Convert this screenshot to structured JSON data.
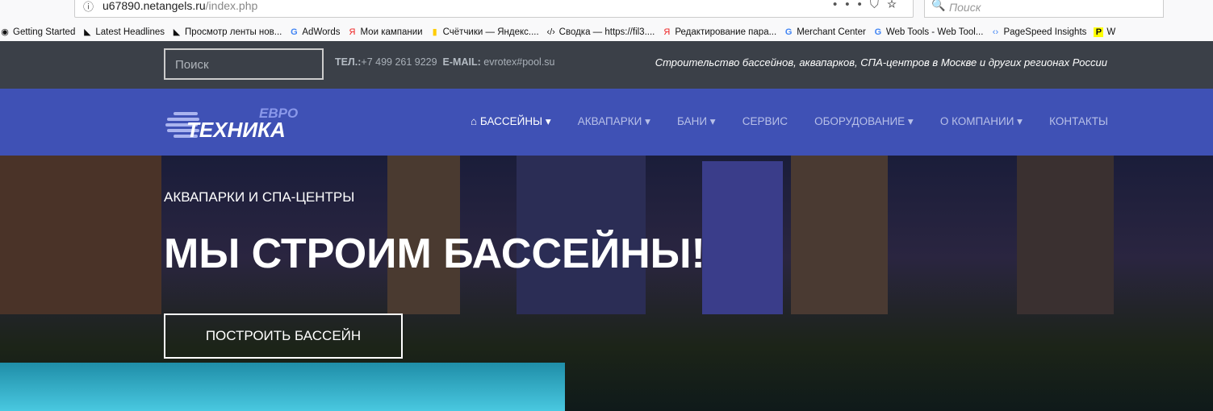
{
  "browser": {
    "url_host": "u67890.netangels.ru",
    "url_path": "/index.php",
    "search_placeholder": "Поиск",
    "bookmarks": [
      "Getting Started",
      "Latest Headlines",
      "Просмотр ленты нов...",
      "AdWords",
      "Мои кампании",
      "Счётчики — Яндекс....",
      "Сводка — https://fil3....",
      "Редактирование пара...",
      "Merchant Center",
      "Web Tools - Web Tool...",
      "PageSpeed Insights",
      "W"
    ]
  },
  "topbar": {
    "search_placeholder": "Поиск",
    "tel_label": "ТЕЛ.:",
    "tel": "+7 499 261 9229",
    "email_label": "E-MAIL:",
    "email": "evrotex#pool.su",
    "slogan": "Строительство бассейнов, аквапарков, СПА-центров в Москве и других регионах России"
  },
  "logo": {
    "top": "ЕВРО",
    "main": "ТЕХНИКА"
  },
  "nav": [
    "БАССЕЙНЫ ▾",
    "АКВАПАРКИ ▾",
    "БАНИ ▾",
    "СЕРВИС",
    "ОБОРУДОВАНИЕ ▾",
    "О КОМПАНИИ ▾",
    "КОНТАКТЫ"
  ],
  "hero": {
    "subtitle": "АКВАПАРКИ И СПА-ЦЕНТРЫ",
    "title": "МЫ СТРОИМ БАССЕЙНЫ!",
    "button": "ПОСТРОИТЬ БАССЕЙН"
  }
}
